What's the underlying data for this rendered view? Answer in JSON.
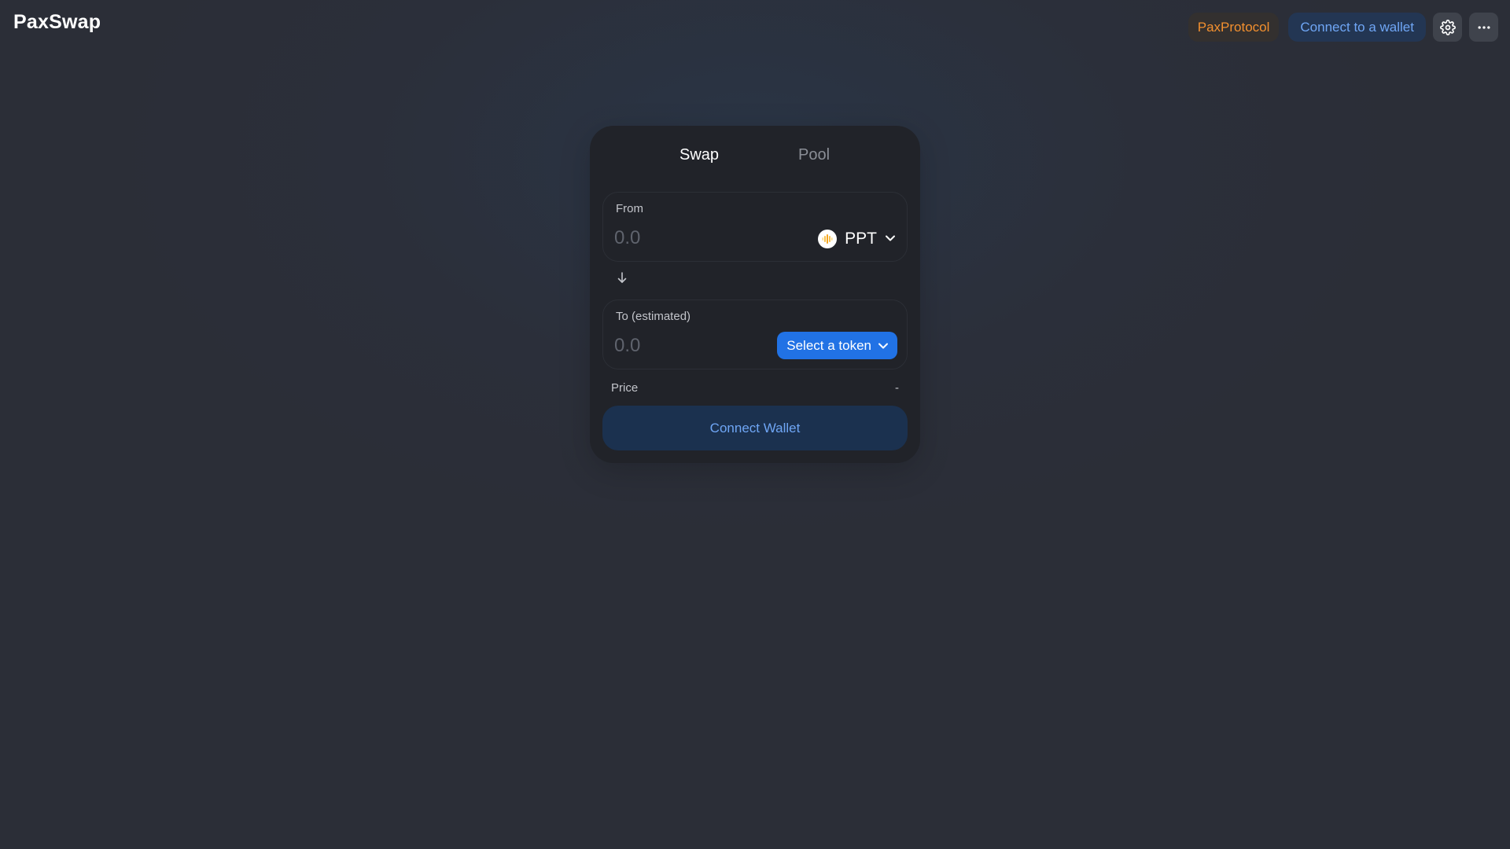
{
  "app": {
    "name": "PaxSwap"
  },
  "header": {
    "protocol_label": "PaxProtocol",
    "connect_label": "Connect to a wallet",
    "settings_icon": "gear-icon",
    "more_icon": "ellipsis-icon"
  },
  "tabs": [
    {
      "label": "Swap",
      "active": true
    },
    {
      "label": "Pool",
      "active": false
    }
  ],
  "from": {
    "label": "From",
    "placeholder": "0.0",
    "token_symbol": "PPT"
  },
  "to": {
    "label": "To (estimated)",
    "placeholder": "0.0",
    "select_label": "Select a token"
  },
  "price": {
    "label": "Price",
    "value": "-"
  },
  "action": {
    "connect_label": "Connect Wallet"
  },
  "colors": {
    "accent_orange": "#f3902f",
    "accent_blue": "#2172e5",
    "link_blue": "#6fa6f5",
    "card_bg": "#212329",
    "page_bg": "#2b2e37"
  }
}
